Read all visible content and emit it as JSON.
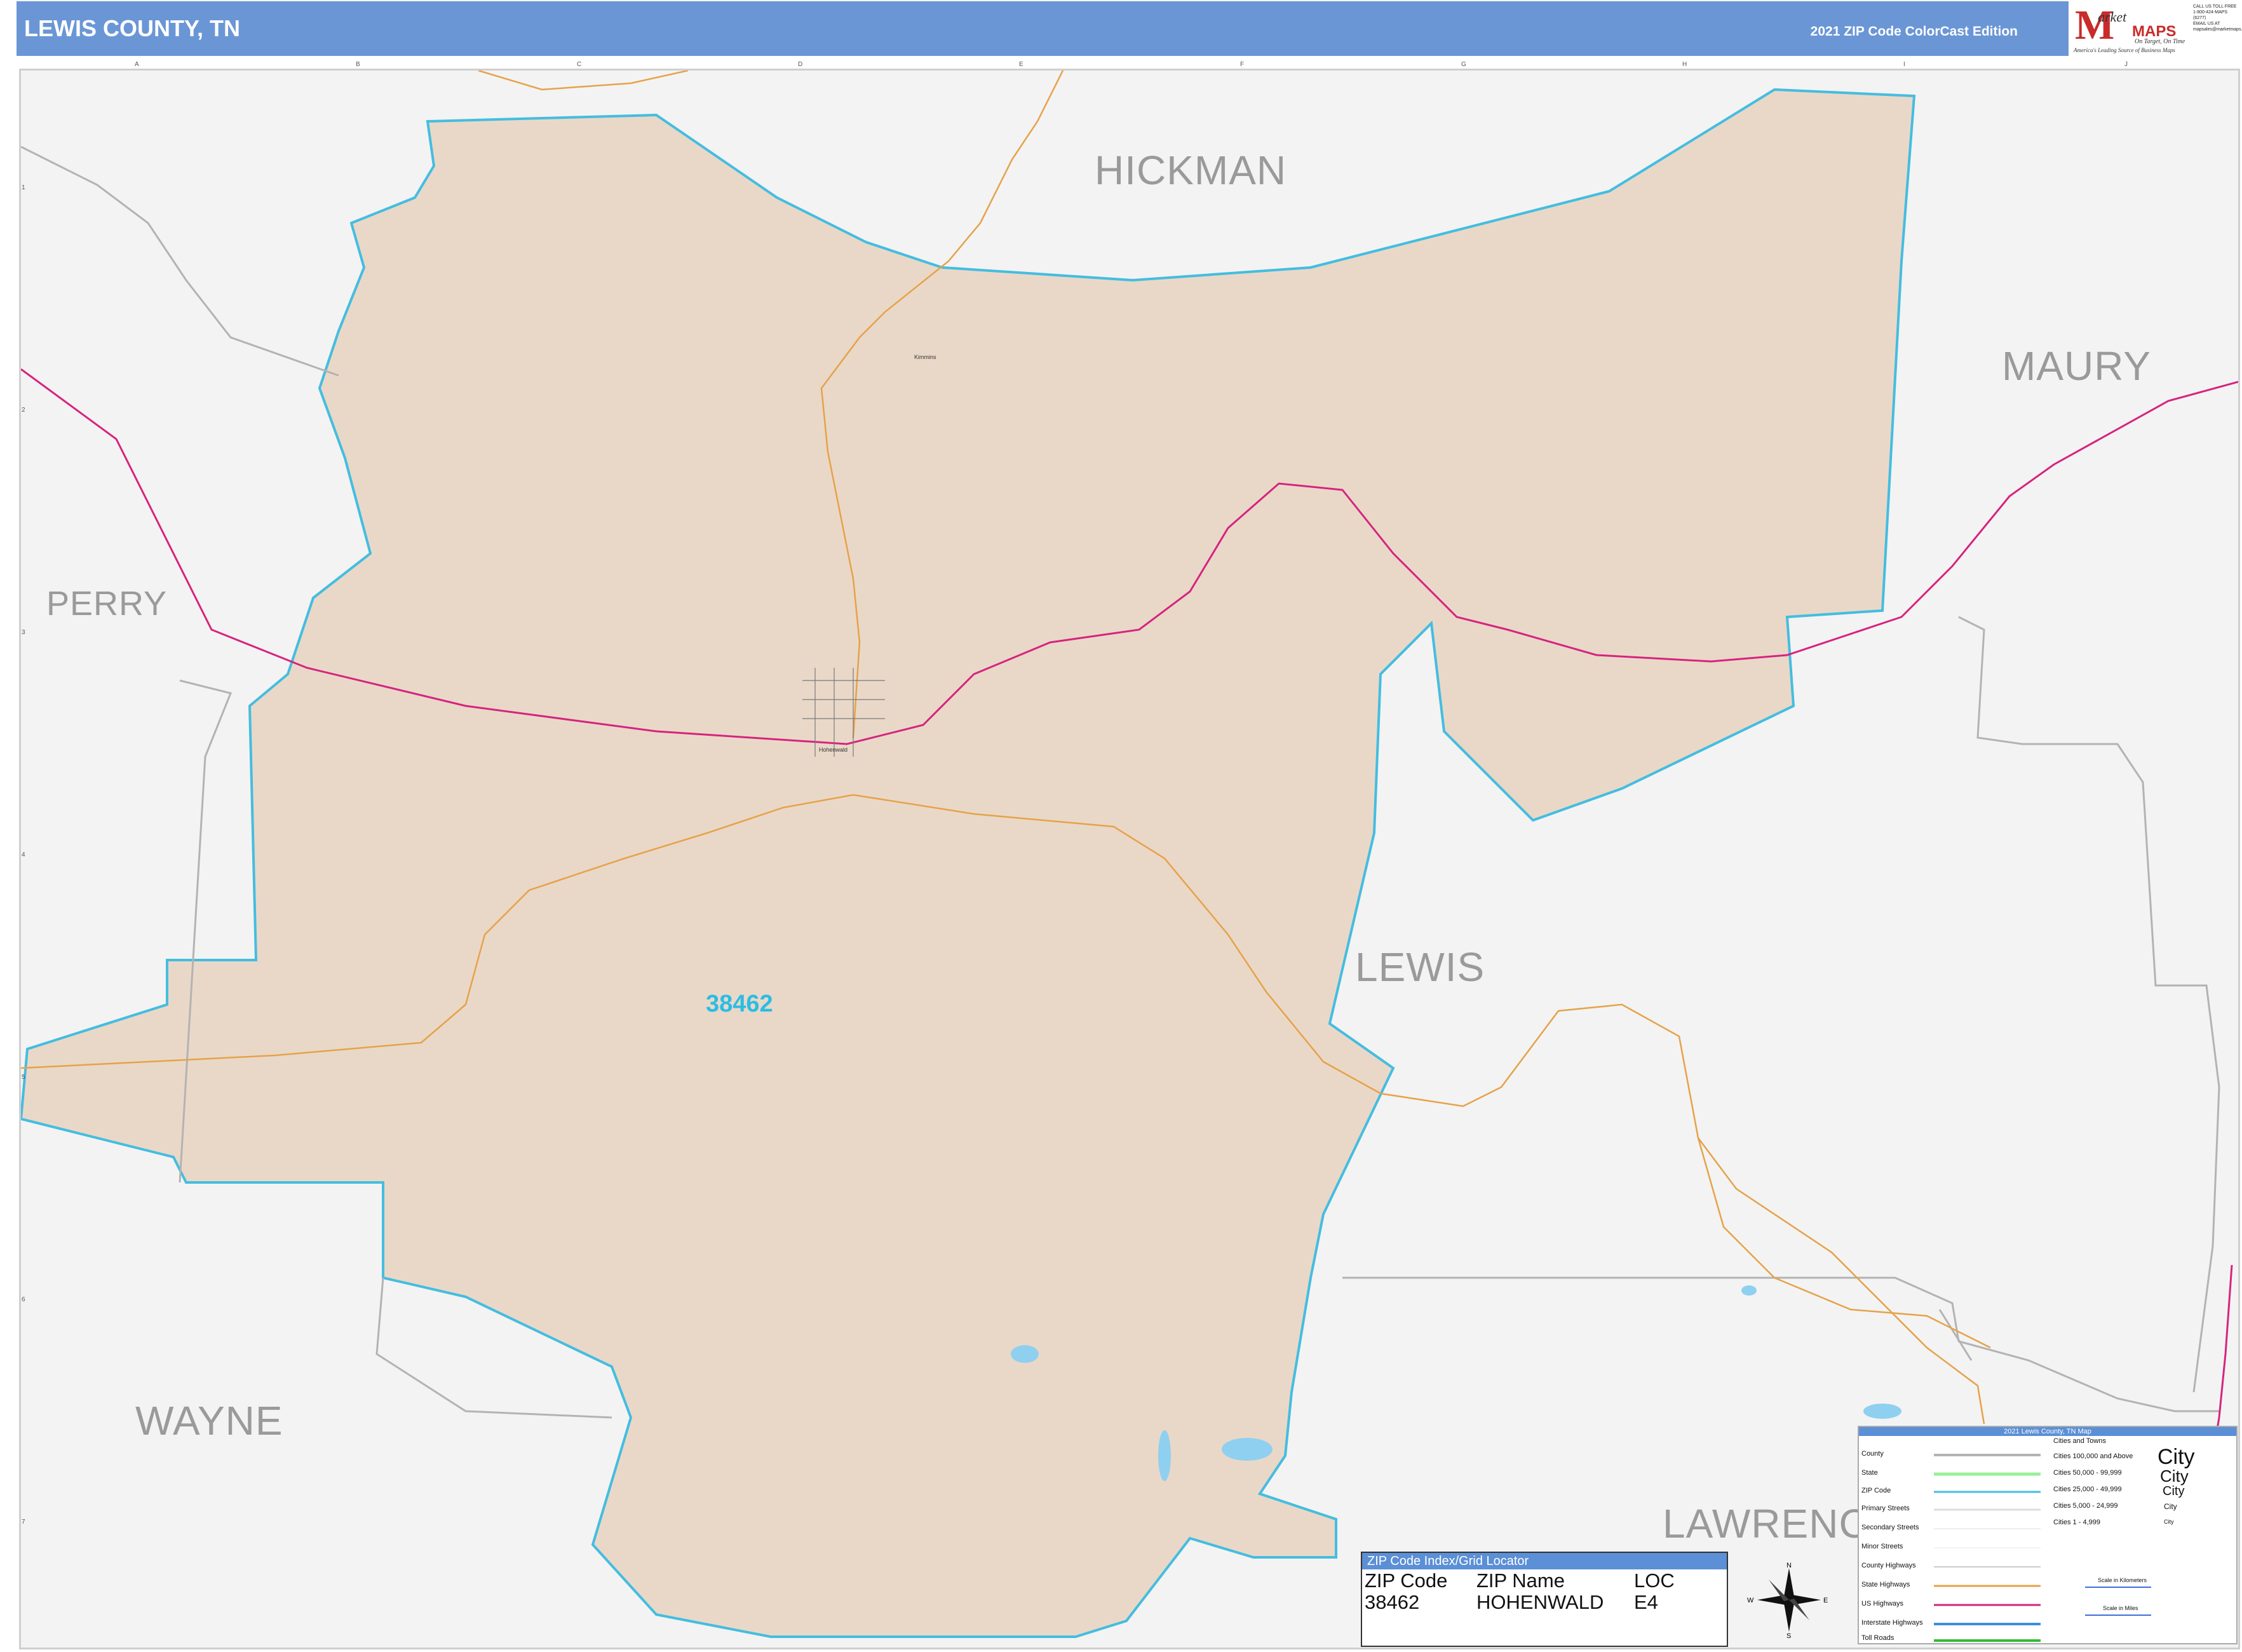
{
  "header": {
    "title": "LEWIS COUNTY, TN",
    "edition": "2021 ZIP Code ColorCast Edition"
  },
  "logo": {
    "m": "M",
    "market": "arket",
    "maps": "MAPS",
    "tagline1": "On Target, On Time",
    "tagline2": "America's Leading Source of Business Maps"
  },
  "contact": {
    "line1": "CALL US TOLL FREE",
    "line2": "1-800-424-MAPS (6277)",
    "line3": "EMAIL US AT",
    "line4": "mapsales@marketmaps.com"
  },
  "grid": {
    "columns": [
      "A",
      "B",
      "C",
      "D",
      "E",
      "F",
      "G",
      "H",
      "I",
      "J"
    ],
    "rows": [
      "1",
      "2",
      "3",
      "4",
      "5",
      "6",
      "7"
    ]
  },
  "counties": {
    "hickman": "HICKMAN",
    "maury": "MAURY",
    "perry": "PERRY",
    "lewis": "LEWIS",
    "wayne": "WAYNE",
    "lawrence": "LAWRENC"
  },
  "zip_area": {
    "code": "38462"
  },
  "places": {
    "kimmins": "Kimmins",
    "hohenwald": "Hohenwald"
  },
  "colors": {
    "zip_fill": "#e9d8c8",
    "zip_border": "#44bde0",
    "county_line": "#b3b3b3",
    "us_highway": "#d6247e",
    "state_highway": "#e6a249",
    "background": "#f3f3f3",
    "header": "#6a96d6"
  },
  "zip_index": {
    "title": "ZIP Code Index/Grid Locator",
    "headers": {
      "code": "ZIP Code",
      "name": "ZIP Name",
      "loc": "LOC"
    },
    "rows": [
      {
        "code": "38462",
        "name": "HOHENWALD",
        "loc": "E4"
      }
    ]
  },
  "legend": {
    "title": "2021 Lewis County, TN Map",
    "county": "County",
    "state": "State",
    "zip_code": "ZIP Code",
    "primary": "Primary Streets",
    "secondary": "Secondary Streets",
    "minor": "Minor Streets",
    "county_hwy": "County Highways",
    "state_hwy": "State Highways",
    "us_hwy": "US Highways",
    "interstate": "Interstate Highways",
    "toll": "Toll Roads",
    "cities_head": "Cities and Towns",
    "c1": "Cities 100,000 and Above",
    "c2": "Cities 50,000 - 99,999",
    "c3": "Cities 25,000 - 49,999",
    "c4": "Cities 5,000 - 24,999",
    "c5": "Cities 1 - 4,999",
    "city": "City",
    "scale_km": "Scale in Kilometers",
    "scale_mi": "Scale in Miles"
  },
  "compass": {
    "n": "N",
    "s": "S",
    "e": "E",
    "w": "W"
  }
}
